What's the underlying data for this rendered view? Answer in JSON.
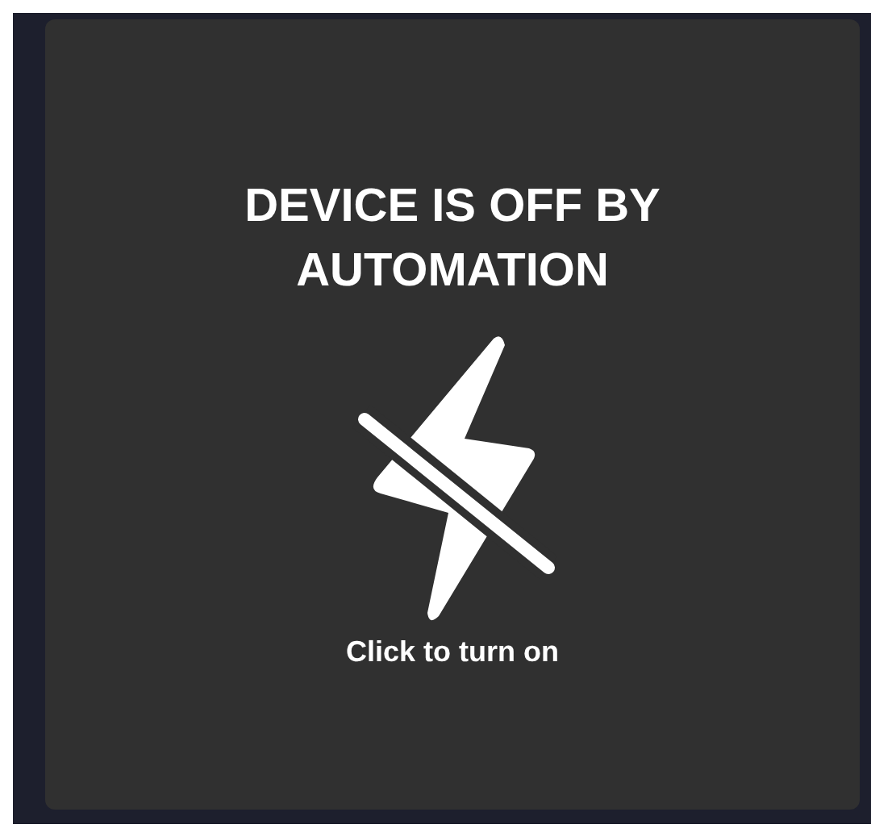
{
  "card": {
    "title": "DEVICE IS OFF BY AUTOMATION",
    "action": "Click to turn on"
  }
}
